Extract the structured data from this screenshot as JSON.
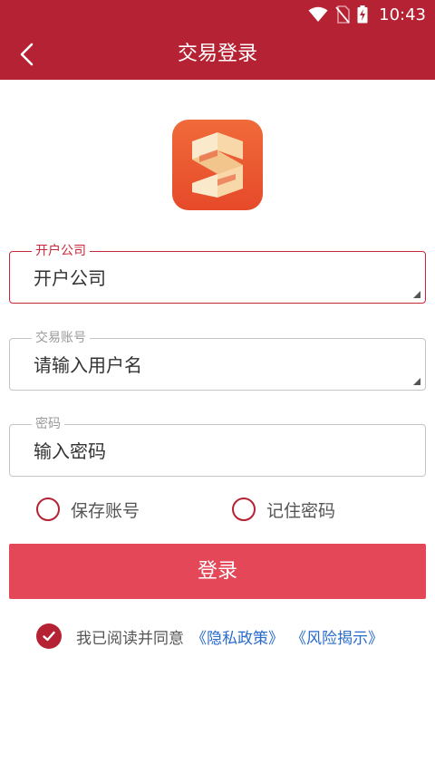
{
  "status_bar": {
    "time": "10:43",
    "icons": [
      "wifi-icon",
      "no-sim-icon",
      "battery-charging-icon"
    ]
  },
  "app_bar": {
    "title": "交易登录",
    "back_icon": "back-arrow-icon"
  },
  "logo": {
    "icon": "app-logo-s"
  },
  "form": {
    "company": {
      "label": "开户公司",
      "value": "开户公司"
    },
    "account": {
      "label": "交易账号",
      "placeholder": "请输入用户名"
    },
    "password": {
      "label": "密码",
      "placeholder": "输入密码"
    }
  },
  "options": {
    "save_account": "保存账号",
    "remember_password": "记住密码"
  },
  "login_button": "登录",
  "agreement": {
    "text": "我已阅读并同意",
    "privacy_link": "《隐私政策》",
    "risk_link": "《风险揭示》"
  },
  "colors": {
    "primary": "#b52233",
    "button": "#e34758",
    "link": "#2a6ccd"
  }
}
